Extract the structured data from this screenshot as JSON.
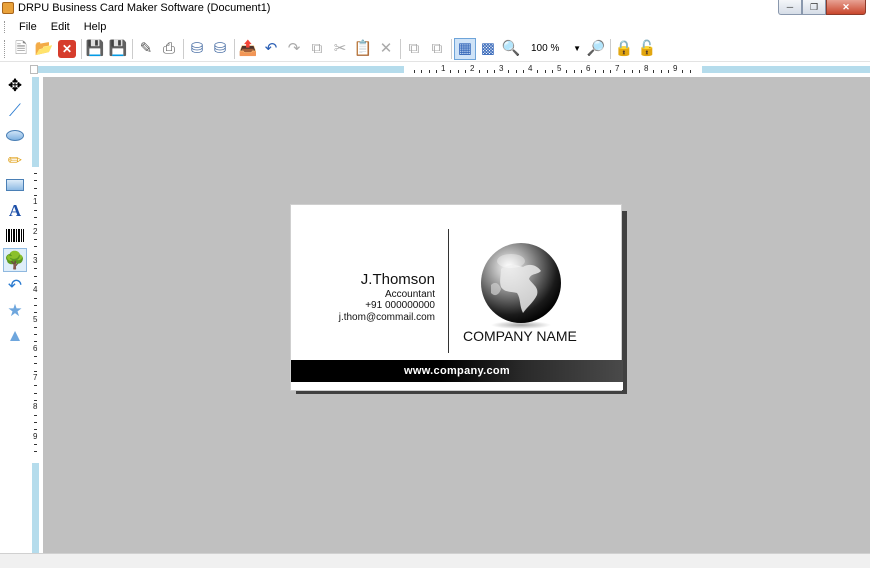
{
  "window": {
    "title": "DRPU Business Card Maker Software  (Document1)",
    "icons": {
      "minimize": "minimize-icon",
      "maximize": "maximize-icon",
      "close": "close-icon"
    }
  },
  "menu": [
    "File",
    "Edit",
    "Help"
  ],
  "toolbar": {
    "zoom": "100 %",
    "buttons": [
      "new-document-icon",
      "open-folder-icon",
      "close-document-icon",
      "save-icon",
      "save-as-icon",
      "edit-icon",
      "print-icon",
      "database-icon",
      "database-export-icon",
      "export-icon",
      "undo-icon",
      "redo-icon",
      "copy-icon",
      "cut-icon",
      "paste-icon",
      "delete-icon",
      "bring-front-icon",
      "send-back-icon",
      "grid-icon",
      "snap-grid-icon",
      "zoom-in-icon",
      "zoom-out-icon",
      "lock-icon",
      "unlock-icon"
    ]
  },
  "tools": [
    "select-move-icon",
    "line-icon",
    "ellipse-icon",
    "pencil-icon",
    "rectangle-icon",
    "text-icon",
    "barcode-icon",
    "image-icon",
    "curve-icon",
    "star-icon",
    "triangle-icon"
  ],
  "ruler": {
    "h_labels": [
      "1",
      "2",
      "3",
      "4",
      "5",
      "6",
      "7",
      "8",
      "9"
    ],
    "v_labels": [
      "1",
      "2",
      "3",
      "4",
      "5",
      "6",
      "7",
      "8",
      "9"
    ]
  },
  "card": {
    "name": "J.Thomson",
    "title": "Accountant",
    "phone": "+91 000000000",
    "email": "j.thom@commail.com",
    "company": "COMPANY NAME",
    "website": "www.company.com",
    "graphic": "globe-icon"
  }
}
